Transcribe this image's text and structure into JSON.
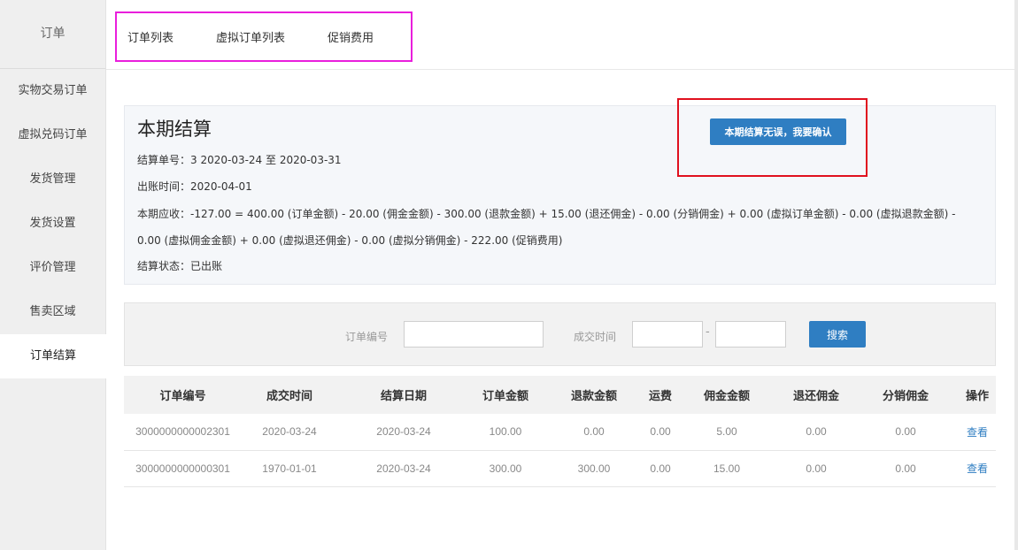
{
  "sidebar": {
    "header": "订单",
    "items": [
      {
        "label": "实物交易订单",
        "active": false
      },
      {
        "label": "虚拟兑码订单",
        "active": false
      },
      {
        "label": "发货管理",
        "active": false
      },
      {
        "label": "发货设置",
        "active": false
      },
      {
        "label": "评价管理",
        "active": false
      },
      {
        "label": "售卖区域",
        "active": false
      },
      {
        "label": "订单结算",
        "active": true
      }
    ]
  },
  "tabs": [
    "订单列表",
    "虚拟订单列表",
    "促销费用"
  ],
  "summary": {
    "title": "本期结算",
    "settlement_line": "结算单号：3    2020-03-24  至  2020-03-31",
    "billing_time": "出账时间：2020-04-01",
    "receivable": "本期应收：-127.00 = 400.00 (订单金额) - 20.00 (佣金金额) - 300.00 (退款金额) + 15.00 (退还佣金) - 0.00 (分销佣金) + 0.00 (虚拟订单金额) - 0.00 (虚拟退款金额) - 0.00 (虚拟佣金金额) + 0.00 (虚拟退还佣金) - 0.00 (虚拟分销佣金) - 222.00 (促销费用)",
    "status": "结算状态：已出账",
    "confirm_label": "本期结算无误，我要确认"
  },
  "search": {
    "order_no_label": "订单编号",
    "order_no_value": "",
    "deal_time_label": "成交时间",
    "date_from": "",
    "date_to": "",
    "separator": "-",
    "search_label": "搜索"
  },
  "table": {
    "headers": [
      "订单编号",
      "成交时间",
      "结算日期",
      "订单金额",
      "退款金额",
      "运费",
      "佣金金额",
      "退还佣金",
      "分销佣金",
      "操作"
    ],
    "rows": [
      [
        "3000000000002301",
        "2020-03-24",
        "2020-03-24",
        "100.00",
        "0.00",
        "0.00",
        "5.00",
        "0.00",
        "0.00",
        "查看"
      ],
      [
        "3000000000000301",
        "1970-01-01",
        "2020-03-24",
        "300.00",
        "300.00",
        "0.00",
        "15.00",
        "0.00",
        "0.00",
        "查看"
      ]
    ]
  },
  "colors": {
    "primary_button": "#2f7ec2",
    "tabs_highlight": "#e91edc",
    "confirm_highlight": "#e0101e"
  }
}
